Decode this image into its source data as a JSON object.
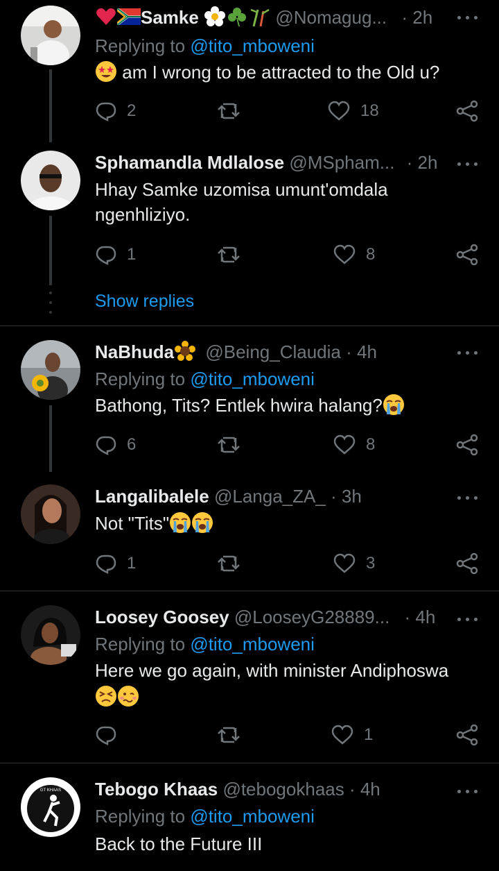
{
  "tweets": [
    {
      "name": "Samke",
      "name_prefix_emoji": "❤️🇿🇦",
      "name_suffix_emoji": "🌼☘️🎋",
      "handle": "@Nomagug...",
      "time": "· 2h",
      "replying_prefix": "Replying to",
      "replying_mention": "@tito_mboweni",
      "text_emoji": "🤩",
      "text": "am I wrong to be attracted to the Old u?",
      "replies": "2",
      "retweets": "",
      "likes": "18"
    },
    {
      "name": "Sphamandla Mdlalose",
      "handle": "@MSpham...",
      "time": "· 2h",
      "text": "Hhay Samke uzomisa umunt'omdala ngenhliziyo.",
      "replies": "1",
      "retweets": "",
      "likes": "8"
    },
    {
      "name": "NaBhuda",
      "name_suffix_emoji": "🌻",
      "handle": "@Being_Claudia",
      "time": "· 4h",
      "replying_prefix": "Replying to",
      "replying_mention": "@tito_mboweni",
      "text": "Bathong, Tits? Entlek hwira halang?",
      "text_suffix_emoji": "😭",
      "replies": "6",
      "retweets": "",
      "likes": "8"
    },
    {
      "name": "Langalibalele",
      "handle": "@Langa_ZA_",
      "time": "· 3h",
      "text": "Not \"Tits\"",
      "text_suffix_emoji": "😭😭",
      "replies": "1",
      "retweets": "",
      "likes": "3"
    },
    {
      "name": "Loosey Goosey",
      "handle": "@LooseyG28889...",
      "time": "· 4h",
      "replying_prefix": "Replying to",
      "replying_mention": "@tito_mboweni",
      "text": "Here we go again, with minister Andiphoswa",
      "text_line2_emoji": "😣🥴",
      "replies": "",
      "retweets": "",
      "likes": "1"
    },
    {
      "name": "Tebogo Khaas",
      "handle": "@tebogokhaas",
      "time": "· 4h",
      "replying_prefix": "Replying to",
      "replying_mention": "@tito_mboweni",
      "text": "Back to the Future III",
      "avatar_badge_text": "GT KHAAS"
    }
  ],
  "show_replies_label": "Show replies",
  "icons": {
    "reply": "reply-icon",
    "retweet": "retweet-icon",
    "like": "heart-icon",
    "share": "share-icon",
    "more": "more-icon"
  },
  "colors": {
    "background": "#000000",
    "text": "#e7e9ea",
    "muted": "#71767b",
    "link": "#1d9bf0",
    "divider": "#2f3336"
  }
}
